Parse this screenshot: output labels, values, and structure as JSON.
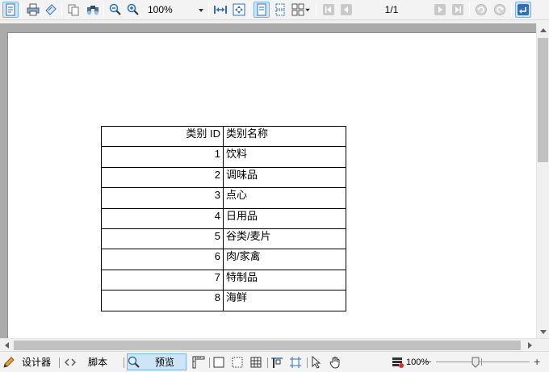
{
  "toolbar": {
    "zoom_value": "100%",
    "page_counter": "1/1",
    "icons": [
      "open-report-icon",
      "print-icon",
      "page-setup-icon",
      "copy-icon",
      "find-icon",
      "zoom-out-icon",
      "zoom-in-icon",
      "fit-width-icon",
      "fit-page-icon",
      "single-page-icon",
      "continuous-page-icon",
      "multi-page-icon",
      "first-page-icon",
      "previous-page-icon",
      "next-page-icon",
      "last-page-icon",
      "back-icon",
      "forward-icon",
      "exit-preview-icon"
    ]
  },
  "report": {
    "headers": {
      "id": "类别 ID",
      "name": "类别名称"
    },
    "rows": [
      {
        "id": "1",
        "name": "饮料"
      },
      {
        "id": "2",
        "name": "调味品"
      },
      {
        "id": "3",
        "name": "点心"
      },
      {
        "id": "4",
        "name": "日用品"
      },
      {
        "id": "5",
        "name": "谷类/麦片"
      },
      {
        "id": "6",
        "name": "肉/家禽"
      },
      {
        "id": "7",
        "name": "特制品"
      },
      {
        "id": "8",
        "name": "海鲜"
      }
    ]
  },
  "bottombar": {
    "designer_label": "设计器",
    "script_label": "脚本",
    "preview_label": "预览",
    "zoom_percent": "100%",
    "zoom_minus": "−",
    "zoom_plus": "+"
  },
  "colors": {
    "accent_active": "#cde5f7",
    "accent_border": "#7ab3de",
    "doc_background": "#ababab",
    "icon_blue": "#2f6fb5"
  }
}
